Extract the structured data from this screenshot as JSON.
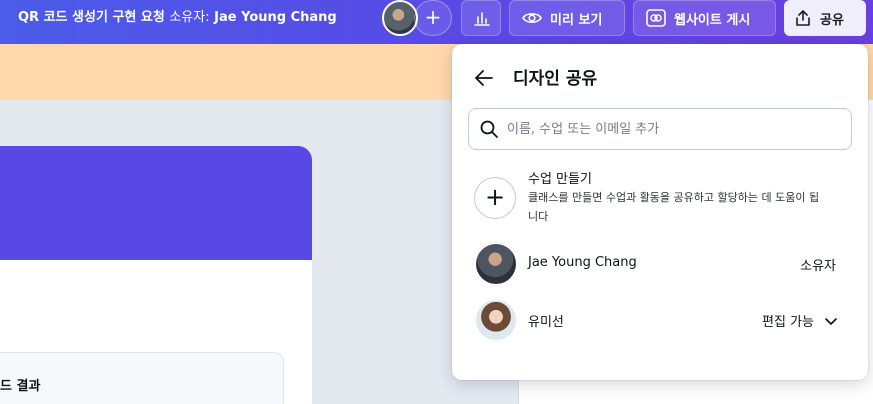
{
  "header": {
    "doc_title": "QR 코드 생성기 구현 요청",
    "owner_label": "소유자:",
    "owner_name": "Jae Young Chang",
    "add_collaborator_label": "+",
    "preview_label": "미리 보기",
    "publish_label": "웹사이트 게시",
    "share_label": "공유"
  },
  "canvas": {
    "result_label": "드 결과"
  },
  "share_panel": {
    "title": "디자인 공유",
    "search_placeholder": "이름, 수업 또는 이메일 추가",
    "search_value": "",
    "create_class": {
      "title": "수업 만들기",
      "description": "클래스를 만들면 수업과 활동을 공유하고 할당하는 데 도움이 됩니다"
    },
    "members": [
      {
        "name": "Jae Young Chang",
        "role": "소유자"
      },
      {
        "name": "유미선",
        "role": "편집 가능"
      }
    ]
  },
  "colors": {
    "topbar_start": "#4a5ce8",
    "topbar_end": "#6a3fe0",
    "banner": "#ffd9ab",
    "card_header": "#5a48e6",
    "share_button_bg": "#f1eefc"
  },
  "icons": {
    "stats": "bar-chart-icon",
    "preview": "eye-icon",
    "publish": "publish-icon",
    "share": "upload-icon",
    "back": "arrow-left-icon",
    "search": "search-icon",
    "create": "plus-icon",
    "dropdown": "chevron-down-icon"
  }
}
